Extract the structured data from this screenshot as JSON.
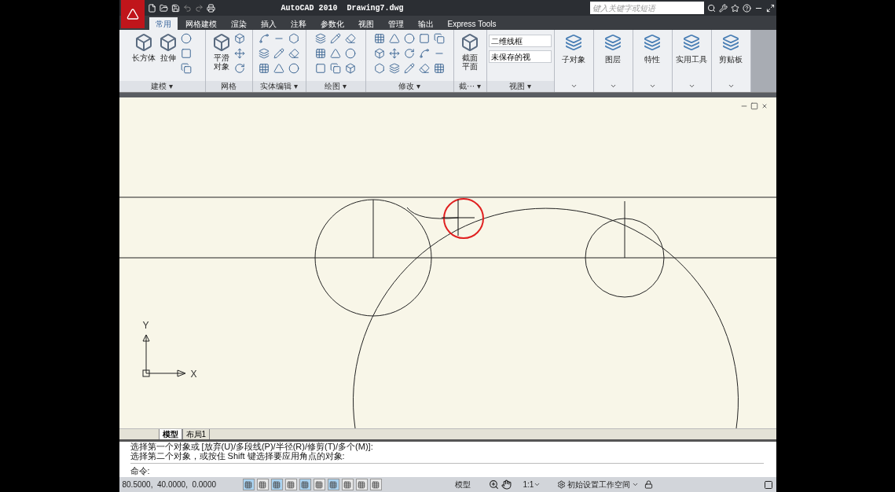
{
  "window": {
    "title": "AutoCAD 2010  Drawing7.dwg"
  },
  "search": {
    "placeholder": "键入关键字或短语"
  },
  "tabs": [
    {
      "label": "常用",
      "selected": true
    },
    {
      "label": "网格建模",
      "selected": false
    },
    {
      "label": "渲染",
      "selected": false
    },
    {
      "label": "插入",
      "selected": false
    },
    {
      "label": "注释",
      "selected": false
    },
    {
      "label": "参数化",
      "selected": false
    },
    {
      "label": "视图",
      "selected": false
    },
    {
      "label": "管理",
      "selected": false
    },
    {
      "label": "输出",
      "selected": false
    },
    {
      "label": "Express Tools",
      "selected": false
    }
  ],
  "ribbon": {
    "panels": [
      {
        "kind": "tools",
        "title": "建模 ▾",
        "large": [
          "长方体",
          "拉伸"
        ]
      },
      {
        "kind": "tools",
        "title": "网格",
        "large": [
          "平滑对象"
        ]
      },
      {
        "kind": "tools",
        "title": "实体编辑 ▾"
      },
      {
        "kind": "tools",
        "title": "绘图 ▾"
      },
      {
        "kind": "tools",
        "title": "修改 ▾"
      },
      {
        "kind": "tools",
        "title": "截··· ▾",
        "large": [
          "截面平面"
        ]
      },
      {
        "kind": "view",
        "title": "视图 ▾",
        "dropdowns": [
          "二维线框",
          "未保存的视"
        ]
      },
      {
        "kind": "button",
        "label": "子对象"
      },
      {
        "kind": "button",
        "label": "图层"
      },
      {
        "kind": "button",
        "label": "特性"
      },
      {
        "kind": "button",
        "label": "实用工具"
      },
      {
        "kind": "button",
        "label": "剪贴板"
      }
    ]
  },
  "canvas": {
    "axis_x": "X",
    "axis_y": "Y"
  },
  "layout_tabs": [
    {
      "label": "模型",
      "selected": true
    },
    {
      "label": "布局1",
      "selected": false
    }
  ],
  "command": {
    "history": [
      "选择第一个对象或 [放弃(U)/多段线(P)/半径(R)/修剪(T)/多个(M)]:",
      "选择第二个对象，或按住 Shift 键选择要应用角点的对象:"
    ],
    "prompt": "命令:"
  },
  "status_bar": {
    "coordinates": "80.5000,  40.0000,  0.0000",
    "toggles": [
      {
        "on": true
      },
      {
        "on": false
      },
      {
        "on": true
      },
      {
        "on": false
      },
      {
        "on": true
      },
      {
        "on": false
      },
      {
        "on": true
      },
      {
        "on": false
      },
      {
        "on": false
      },
      {
        "on": false
      }
    ],
    "space": "模型",
    "scale": "1:1",
    "workspace": "初始设置工作空间"
  }
}
